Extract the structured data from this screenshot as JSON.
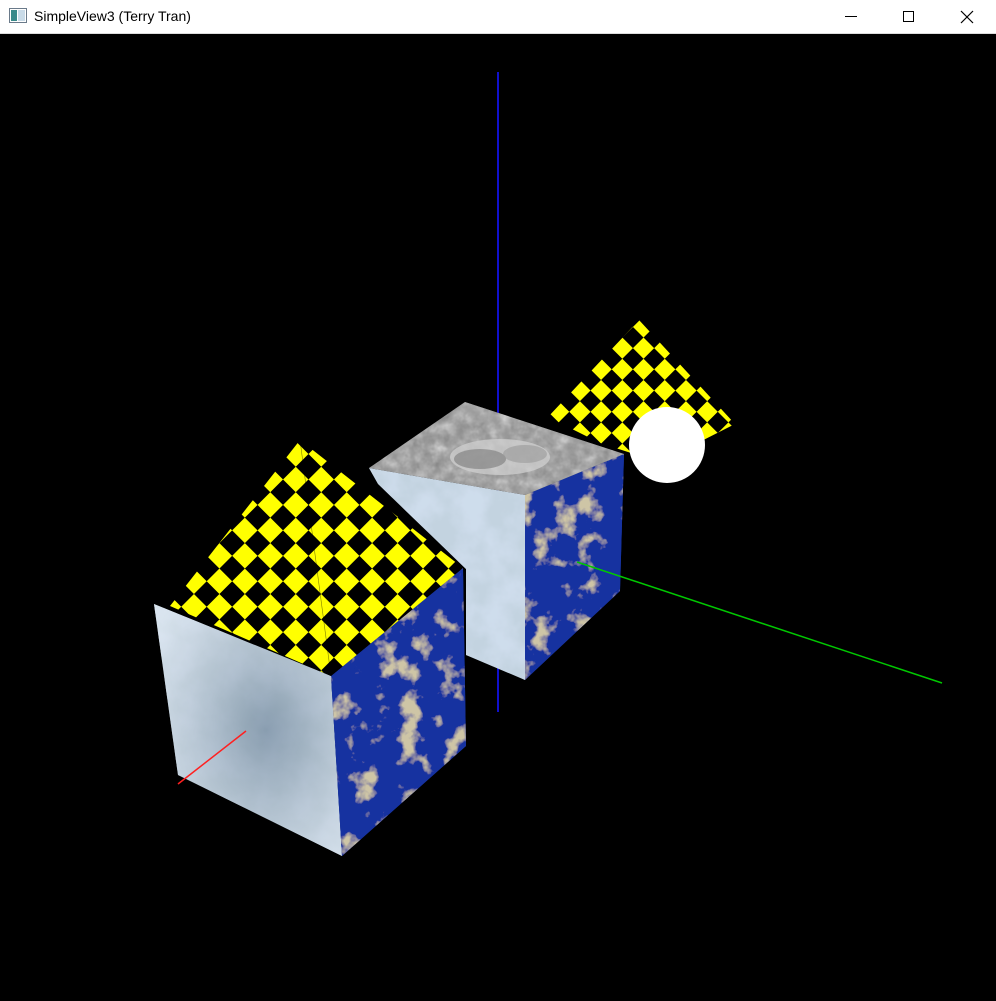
{
  "window": {
    "title": "SimpleView3 (Terry Tran)",
    "app_icon": "window-app-icon",
    "controls": [
      "minimize-icon",
      "maximize-icon",
      "close-icon"
    ]
  },
  "scene": {
    "background_color": "#000000",
    "axis_colors": {
      "x": "#ff2020",
      "y": "#00cc00",
      "z": "#1010cc"
    },
    "objects": [
      "yellow-black checkered pyramid",
      "ice textured cube",
      "earth textured cube",
      "stone textured cube",
      "white sphere"
    ],
    "checker_colors": [
      "#ffff00",
      "#000000"
    ]
  }
}
